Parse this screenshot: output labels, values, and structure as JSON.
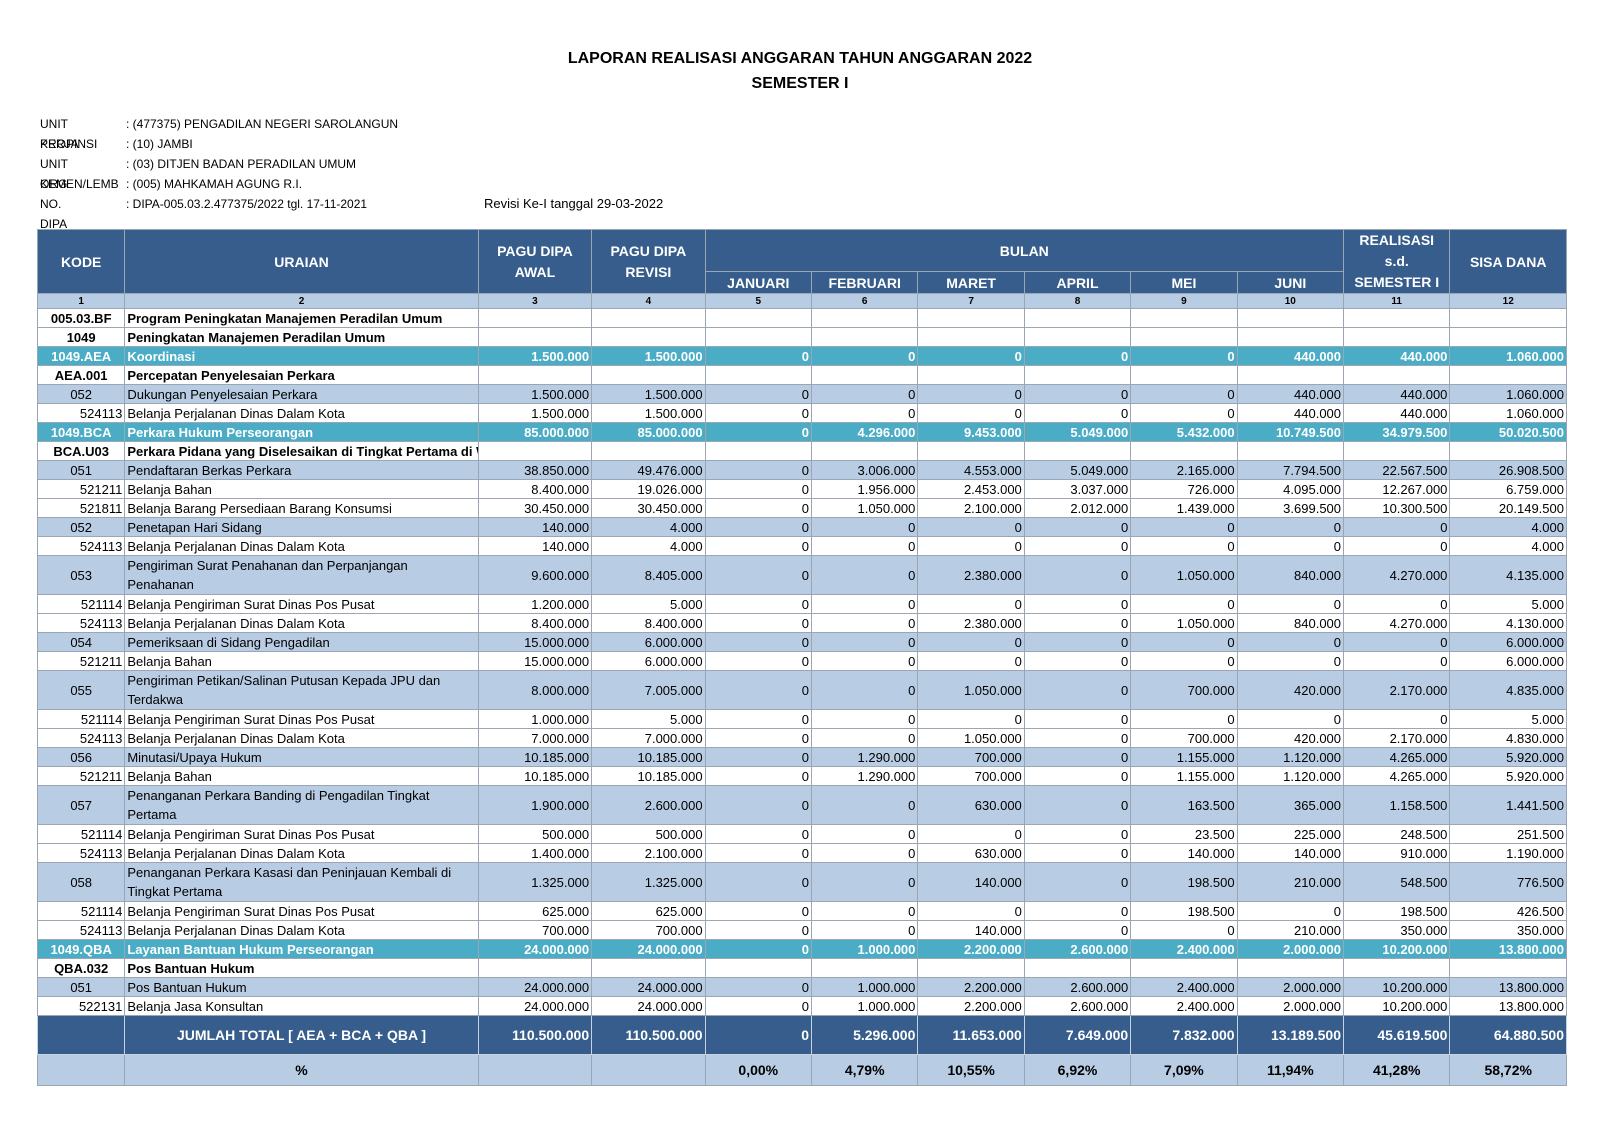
{
  "header": {
    "title": "LAPORAN REALISASI ANGGARAN TAHUN ANGGARAN 2022",
    "subtitle": "SEMESTER I"
  },
  "meta": [
    {
      "label": "UNIT KERJA",
      "value": ": (477375) PENGADILAN NEGERI SAROLANGUN"
    },
    {
      "label": "PROPINSI",
      "value": ": (10) JAMBI"
    },
    {
      "label": "UNIT ORG",
      "value": ": (03) DITJEN BADAN PERADILAN UMUM"
    },
    {
      "label": "KEMEN/LEMB",
      "value": ": (005) MAHKAMAH AGUNG R.I."
    },
    {
      "label": "NO. DIPA",
      "value": ": DIPA-005.03.2.477375/2022 tgl. 17-11-2021"
    }
  ],
  "revisi": "Revisi Ke-I tanggal 29-03-2022",
  "columns": {
    "kode": "KODE",
    "uraian": "URAIAN",
    "pagu_awal": "PAGU DIPA AWAL",
    "pagu_revisi": "PAGU DIPA REVISI",
    "bulan": "BULAN",
    "months": [
      "JANUARI",
      "FEBRUARI",
      "MARET",
      "APRIL",
      "MEI",
      "JUNI"
    ],
    "realisasi": "REALISASI s.d. SEMESTER I",
    "sisa": "SISA DANA",
    "numbers": [
      "1",
      "2",
      "3",
      "4",
      "5",
      "6",
      "7",
      "8",
      "9",
      "10",
      "11",
      "12"
    ]
  },
  "rows": [
    {
      "k": "005.03.BF",
      "u": "Program Peningkatan Manajemen Peradilan Umum",
      "v": [
        "",
        "",
        "",
        "",
        "",
        "",
        "",
        "",
        "",
        "",
        ""
      ],
      "s": "plain",
      "b": true
    },
    {
      "k": "1049",
      "u": "Peningkatan Manajemen Peradilan Umum",
      "v": [
        "",
        "",
        "",
        "",
        "",
        "",
        "",
        "",
        "",
        ""
      ],
      "s": "plain",
      "b": true
    },
    {
      "k": "1049.AEA",
      "u": "Koordinasi",
      "v": [
        "1.500.000",
        "1.500.000",
        "0",
        "0",
        "0",
        "0",
        "0",
        "440.000",
        "440.000",
        "1.060.000"
      ],
      "s": "hl",
      "b": true
    },
    {
      "k": "AEA.001",
      "u": "Percepatan Penyelesaian Perkara",
      "v": [
        "",
        "",
        "",
        "",
        "",
        "",
        "",
        "",
        "",
        ""
      ],
      "s": "plain",
      "b": true
    },
    {
      "k": "052",
      "u": "Dukungan Penyelesaian Perkara",
      "v": [
        "1.500.000",
        "1.500.000",
        "0",
        "0",
        "0",
        "0",
        "0",
        "440.000",
        "440.000",
        "1.060.000"
      ],
      "s": "sub"
    },
    {
      "k": "524113",
      "u": "Belanja Perjalanan Dinas Dalam Kota",
      "v": [
        "1.500.000",
        "1.500.000",
        "0",
        "0",
        "0",
        "0",
        "0",
        "440.000",
        "440.000",
        "1.060.000"
      ],
      "s": "plain",
      "kr": true
    },
    {
      "k": "1049.BCA",
      "u": "Perkara Hukum Perseorangan",
      "v": [
        "85.000.000",
        "85.000.000",
        "0",
        "4.296.000",
        "9.453.000",
        "5.049.000",
        "5.432.000",
        "10.749.500",
        "34.979.500",
        "50.020.500"
      ],
      "s": "hl",
      "b": true
    },
    {
      "k": "BCA.U03",
      "u": "Perkara Pidana yang Diselesaikan di Tingkat Pertama di Wilayah Barat",
      "v": [
        "",
        "",
        "",
        "",
        "",
        "",
        "",
        "",
        "",
        ""
      ],
      "s": "plain",
      "b": true
    },
    {
      "k": "051",
      "u": "Pendaftaran Berkas Perkara",
      "v": [
        "38.850.000",
        "49.476.000",
        "0",
        "3.006.000",
        "4.553.000",
        "5.049.000",
        "2.165.000",
        "7.794.500",
        "22.567.500",
        "26.908.500"
      ],
      "s": "sub"
    },
    {
      "k": "521211",
      "u": "Belanja Bahan",
      "v": [
        "8.400.000",
        "19.026.000",
        "0",
        "1.956.000",
        "2.453.000",
        "3.037.000",
        "726.000",
        "4.095.000",
        "12.267.000",
        "6.759.000"
      ],
      "s": "plain",
      "kr": true
    },
    {
      "k": "521811",
      "u": "Belanja Barang Persediaan Barang Konsumsi",
      "v": [
        "30.450.000",
        "30.450.000",
        "0",
        "1.050.000",
        "2.100.000",
        "2.012.000",
        "1.439.000",
        "3.699.500",
        "10.300.500",
        "20.149.500"
      ],
      "s": "plain",
      "kr": true
    },
    {
      "k": "052",
      "u": "Penetapan Hari Sidang",
      "v": [
        "140.000",
        "4.000",
        "0",
        "0",
        "0",
        "0",
        "0",
        "0",
        "0",
        "4.000"
      ],
      "s": "sub"
    },
    {
      "k": "524113",
      "u": "Belanja Perjalanan Dinas Dalam Kota",
      "v": [
        "140.000",
        "4.000",
        "0",
        "0",
        "0",
        "0",
        "0",
        "0",
        "0",
        "4.000"
      ],
      "s": "plain",
      "kr": true
    },
    {
      "k": "053",
      "u": "Pengiriman Surat Penahanan dan Perpanjangan Penahanan",
      "v": [
        "9.600.000",
        "8.405.000",
        "0",
        "0",
        "2.380.000",
        "0",
        "1.050.000",
        "840.000",
        "4.270.000",
        "4.135.000"
      ],
      "s": "sub",
      "tall": true
    },
    {
      "k": "521114",
      "u": "Belanja Pengiriman Surat Dinas Pos Pusat",
      "v": [
        "1.200.000",
        "5.000",
        "0",
        "0",
        "0",
        "0",
        "0",
        "0",
        "0",
        "5.000"
      ],
      "s": "plain",
      "kr": true
    },
    {
      "k": "524113",
      "u": "Belanja Perjalanan Dinas Dalam Kota",
      "v": [
        "8.400.000",
        "8.400.000",
        "0",
        "0",
        "2.380.000",
        "0",
        "1.050.000",
        "840.000",
        "4.270.000",
        "4.130.000"
      ],
      "s": "plain",
      "kr": true
    },
    {
      "k": "054",
      "u": "Pemeriksaan di Sidang Pengadilan",
      "v": [
        "15.000.000",
        "6.000.000",
        "0",
        "0",
        "0",
        "0",
        "0",
        "0",
        "0",
        "6.000.000"
      ],
      "s": "sub"
    },
    {
      "k": "521211",
      "u": "Belanja Bahan",
      "v": [
        "15.000.000",
        "6.000.000",
        "0",
        "0",
        "0",
        "0",
        "0",
        "0",
        "0",
        "6.000.000"
      ],
      "s": "plain",
      "kr": true
    },
    {
      "k": "055",
      "u": "Pengiriman Petikan/Salinan Putusan Kepada JPU dan Terdakwa",
      "v": [
        "8.000.000",
        "7.005.000",
        "0",
        "0",
        "1.050.000",
        "0",
        "700.000",
        "420.000",
        "2.170.000",
        "4.835.000"
      ],
      "s": "sub",
      "tall": true
    },
    {
      "k": "521114",
      "u": "Belanja Pengiriman Surat Dinas Pos Pusat",
      "v": [
        "1.000.000",
        "5.000",
        "0",
        "0",
        "0",
        "0",
        "0",
        "0",
        "0",
        "5.000"
      ],
      "s": "plain",
      "kr": true
    },
    {
      "k": "524113",
      "u": "Belanja Perjalanan Dinas Dalam Kota",
      "v": [
        "7.000.000",
        "7.000.000",
        "0",
        "0",
        "1.050.000",
        "0",
        "700.000",
        "420.000",
        "2.170.000",
        "4.830.000"
      ],
      "s": "plain",
      "kr": true
    },
    {
      "k": "056",
      "u": "Minutasi/Upaya Hukum",
      "v": [
        "10.185.000",
        "10.185.000",
        "0",
        "1.290.000",
        "700.000",
        "0",
        "1.155.000",
        "1.120.000",
        "4.265.000",
        "5.920.000"
      ],
      "s": "sub"
    },
    {
      "k": "521211",
      "u": "Belanja Bahan",
      "v": [
        "10.185.000",
        "10.185.000",
        "0",
        "1.290.000",
        "700.000",
        "0",
        "1.155.000",
        "1.120.000",
        "4.265.000",
        "5.920.000"
      ],
      "s": "plain",
      "kr": true
    },
    {
      "k": "057",
      "u": "Penanganan Perkara Banding di Pengadilan Tingkat Pertama",
      "v": [
        "1.900.000",
        "2.600.000",
        "0",
        "0",
        "630.000",
        "0",
        "163.500",
        "365.000",
        "1.158.500",
        "1.441.500"
      ],
      "s": "sub",
      "tall": true
    },
    {
      "k": "521114",
      "u": "Belanja Pengiriman Surat Dinas Pos Pusat",
      "v": [
        "500.000",
        "500.000",
        "0",
        "0",
        "0",
        "0",
        "23.500",
        "225.000",
        "248.500",
        "251.500"
      ],
      "s": "plain",
      "kr": true
    },
    {
      "k": "524113",
      "u": "Belanja Perjalanan Dinas Dalam Kota",
      "v": [
        "1.400.000",
        "2.100.000",
        "0",
        "0",
        "630.000",
        "0",
        "140.000",
        "140.000",
        "910.000",
        "1.190.000"
      ],
      "s": "plain",
      "kr": true
    },
    {
      "k": "058",
      "u": "Penanganan Perkara Kasasi dan Peninjauan Kembali di Tingkat Pertama",
      "v": [
        "1.325.000",
        "1.325.000",
        "0",
        "0",
        "140.000",
        "0",
        "198.500",
        "210.000",
        "548.500",
        "776.500"
      ],
      "s": "sub",
      "tall": true
    },
    {
      "k": "521114",
      "u": "Belanja Pengiriman Surat Dinas Pos Pusat",
      "v": [
        "625.000",
        "625.000",
        "0",
        "0",
        "0",
        "0",
        "198.500",
        "0",
        "198.500",
        "426.500"
      ],
      "s": "plain",
      "kr": true
    },
    {
      "k": "524113",
      "u": "Belanja Perjalanan Dinas Dalam Kota",
      "v": [
        "700.000",
        "700.000",
        "0",
        "0",
        "140.000",
        "0",
        "0",
        "210.000",
        "350.000",
        "350.000"
      ],
      "s": "plain",
      "kr": true
    },
    {
      "k": "1049.QBA",
      "u": "Layanan Bantuan Hukum Perseorangan",
      "v": [
        "24.000.000",
        "24.000.000",
        "0",
        "1.000.000",
        "2.200.000",
        "2.600.000",
        "2.400.000",
        "2.000.000",
        "10.200.000",
        "13.800.000"
      ],
      "s": "hl",
      "b": true
    },
    {
      "k": "QBA.032",
      "u": "Pos Bantuan Hukum",
      "v": [
        "",
        "",
        "",
        "",
        "",
        "",
        "",
        "",
        "",
        ""
      ],
      "s": "plain",
      "b": true
    },
    {
      "k": "051",
      "u": "Pos Bantuan Hukum",
      "v": [
        "24.000.000",
        "24.000.000",
        "0",
        "1.000.000",
        "2.200.000",
        "2.600.000",
        "2.400.000",
        "2.000.000",
        "10.200.000",
        "13.800.000"
      ],
      "s": "sub"
    },
    {
      "k": "522131",
      "u": "Belanja Jasa Konsultan",
      "v": [
        "24.000.000",
        "24.000.000",
        "0",
        "1.000.000",
        "2.200.000",
        "2.600.000",
        "2.400.000",
        "2.000.000",
        "10.200.000",
        "13.800.000"
      ],
      "s": "plain",
      "kr": true
    }
  ],
  "total": {
    "label": "JUMLAH TOTAL [ AEA + BCA + QBA ]",
    "values": [
      "110.500.000",
      "110.500.000",
      "0",
      "5.296.000",
      "11.653.000",
      "7.649.000",
      "7.832.000",
      "13.189.500",
      "45.619.500",
      "64.880.500"
    ]
  },
  "percent": {
    "label": "%",
    "values": [
      "",
      "",
      "0,00%",
      "4,79%",
      "10,55%",
      "6,92%",
      "7,09%",
      "11,94%",
      "41,28%",
      "58,72%"
    ]
  }
}
